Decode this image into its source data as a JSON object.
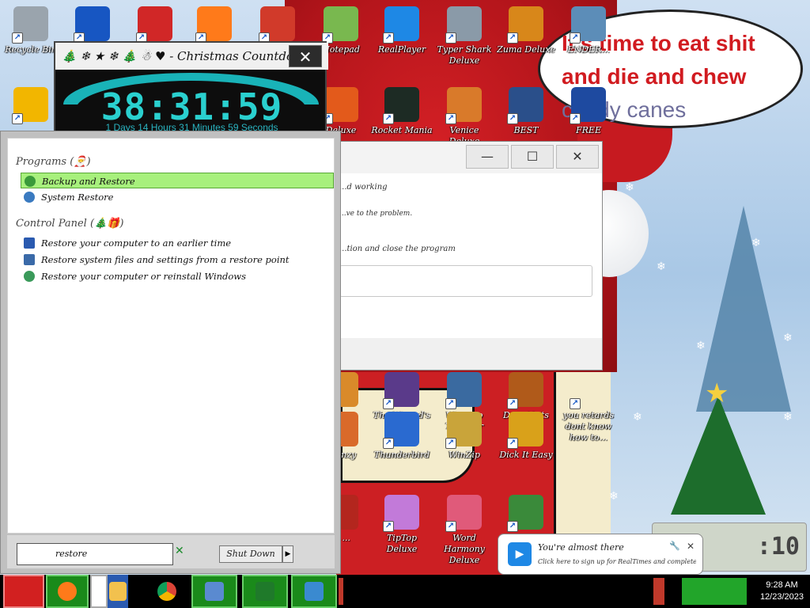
{
  "wallpaper": {
    "bubble_lines": [
      "It's time to eat shit",
      "and die and chew",
      "candy canes"
    ]
  },
  "desktop_icons": [
    {
      "label": "Recycle Bin",
      "icon": "recycle-bin-icon",
      "color": "#9aa4ad"
    },
    {
      "label": "",
      "icon": "app-2-icon",
      "color": "#1756c2"
    },
    {
      "label": "",
      "icon": "red-fluffy-icon",
      "color": "#d12727"
    },
    {
      "label": "",
      "icon": "firefox-icon",
      "color": "#ff7a1a"
    },
    {
      "label": "",
      "icon": "torii-gate-icon",
      "color": "#d13a2a"
    },
    {
      "label": "Notepad",
      "icon": "notepad-icon",
      "color": "#79b84f"
    },
    {
      "label": "RealPlayer",
      "icon": "realplayer-icon",
      "color": "#1e88e5"
    },
    {
      "label": "Typer Shark Deluxe",
      "icon": "typer-shark-icon",
      "color": "#8a9aa8"
    },
    {
      "label": "Zuma Deluxe",
      "icon": "zuma-icon",
      "color": "#d8871a"
    },
    {
      "label": "ENDER...",
      "icon": "window-icon",
      "color": "#5c8db8"
    },
    {
      "label": "",
      "icon": "aimp-icon",
      "color": "#f2b600"
    },
    {
      "label": "Deluxe",
      "icon": "pinball-icon",
      "color": "#e35a1b"
    },
    {
      "label": "Rocket Mania",
      "icon": "rocket-icon",
      "color": "#1d2b24"
    },
    {
      "label": "Venice Deluxe",
      "icon": "venice-icon",
      "color": "#d97a2a"
    },
    {
      "label": "BEST",
      "icon": "xmplay-icon",
      "color": "#2a4f8a"
    },
    {
      "label": "FREE",
      "icon": "free-icon",
      "color": "#1e4aa0"
    },
    {
      "label": "Deluxe",
      "icon": "game-icon",
      "color": "#d98a2a"
    },
    {
      "label": "The Wizard's Pen",
      "icon": "wizard-pen-icon",
      "color": "#5a3a8a"
    },
    {
      "label": "Winaero Tweaker",
      "icon": "winaero-icon",
      "color": "#3a6aa0"
    },
    {
      "label": "Deez Nuts Spy",
      "icon": "spy-icon",
      "color": "#b05a1a"
    },
    {
      "label": "you retards dont know how to...",
      "icon": "text-icon",
      "color": "#f4eccc"
    },
    {
      "label": "Frenzy",
      "icon": "frenzy-icon",
      "color": "#d96a2a"
    },
    {
      "label": "Thunderbird",
      "icon": "thunderbird-icon",
      "color": "#2a6ad0"
    },
    {
      "label": "WinZip",
      "icon": "winzip-icon",
      "color": "#c9a43a"
    },
    {
      "label": "Dick It Easy",
      "icon": "de-icon",
      "color": "#d9a11a"
    },
    {
      "label": "& ...",
      "icon": "game2-icon",
      "color": "#b3261e"
    },
    {
      "label": "TipTop Deluxe",
      "icon": "tiptop-icon",
      "color": "#c27ad9"
    },
    {
      "label": "Word Harmony Deluxe",
      "icon": "word-harmony-icon",
      "color": "#e05a7a"
    },
    {
      "label": "",
      "icon": "window2-icon",
      "color": "#3a8a3a"
    }
  ],
  "countdown": {
    "title": "🎄 ❄ ★ ❄ 🎄 ☃ ♥ - Christmas Countdown",
    "time": "38:31:59",
    "subtitle": "1 Days 14 Hours 31 Minutes 59 Seconds",
    "close": "✕"
  },
  "error_dialog": {
    "line1": "...d working",
    "line2": "...ve to the problem.",
    "line3": "...tion and close the program",
    "minimize": "—",
    "maximize": "☐",
    "close": "✕"
  },
  "start_menu": {
    "programs_header": "Programs (🎅)",
    "programs": [
      {
        "label": "Backup and Restore",
        "icon": "backup-restore-icon",
        "selected": true
      },
      {
        "label": "System Restore",
        "icon": "system-restore-icon",
        "selected": false
      }
    ],
    "control_panel_header": "Control Panel (🎄🎁)",
    "control_panel": [
      {
        "label": "Restore your computer to an earlier time",
        "icon": "flag-icon"
      },
      {
        "label": "Restore system files and settings from a restore point",
        "icon": "restore-point-icon"
      },
      {
        "label": "Restore your computer or reinstall Windows",
        "icon": "recovery-icon"
      }
    ],
    "search_value": "restore",
    "clear": "✕",
    "shutdown_label": "Shut Down",
    "shutdown_arrow": "▶"
  },
  "notification": {
    "title": "You're almost there",
    "body": "Click here to sign up for RealTimes and complete your setup.",
    "close": "✕",
    "settings": "🔧"
  },
  "taskbar": {
    "time": "9:28 AM",
    "date": "12/23/2023"
  }
}
